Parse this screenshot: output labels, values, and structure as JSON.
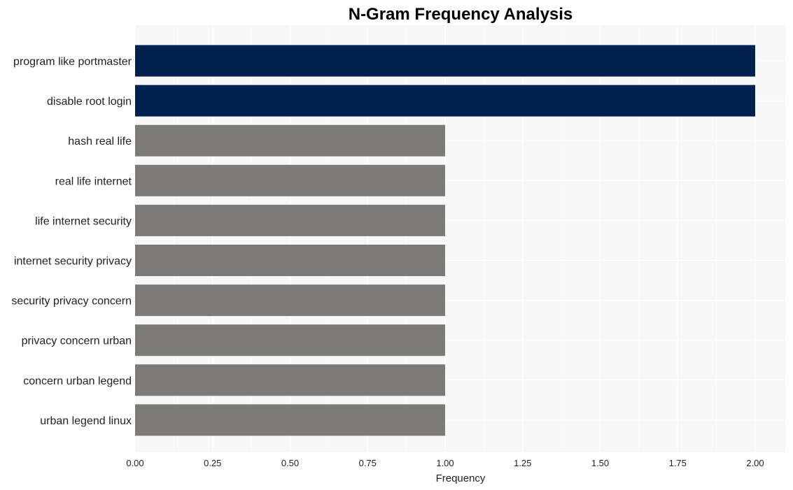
{
  "chart_data": {
    "type": "bar",
    "orientation": "horizontal",
    "title": "N-Gram Frequency Analysis",
    "xlabel": "Frequency",
    "ylabel": "",
    "xlim": [
      0,
      2.1
    ],
    "xticks": [
      "0.00",
      "0.25",
      "0.50",
      "0.75",
      "1.00",
      "1.25",
      "1.50",
      "1.75",
      "2.00"
    ],
    "xtick_values": [
      0,
      0.25,
      0.5,
      0.75,
      1.0,
      1.25,
      1.5,
      1.75,
      2.0
    ],
    "grid": true,
    "categories": [
      "program like portmaster",
      "disable root login",
      "hash real life",
      "real life internet",
      "life internet security",
      "internet security privacy",
      "security privacy concern",
      "privacy concern urban",
      "concern urban legend",
      "urban legend linux"
    ],
    "values": [
      2,
      2,
      1,
      1,
      1,
      1,
      1,
      1,
      1,
      1
    ],
    "colors": {
      "highlight": "#00204e",
      "default": "#7c7b77",
      "plot_background": "#f7f7f7",
      "grid": "#ffffff"
    }
  }
}
